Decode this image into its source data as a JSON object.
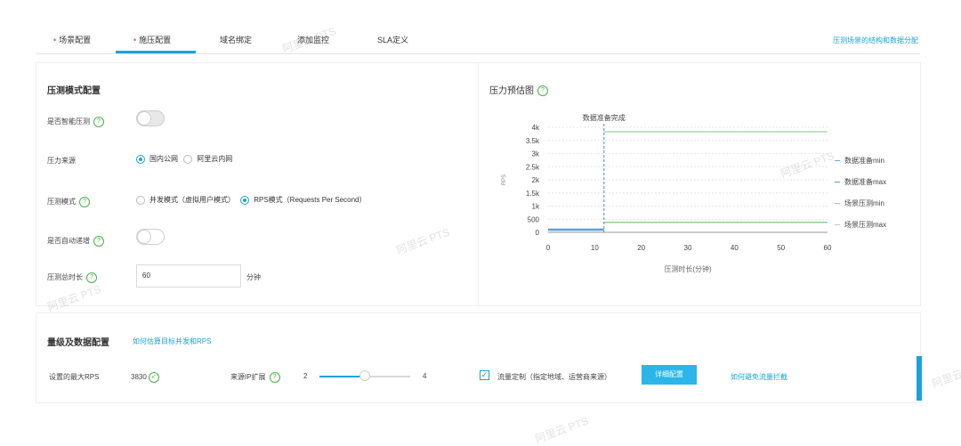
{
  "tabs": [
    {
      "label": "场景配置",
      "required": true
    },
    {
      "label": "施压配置",
      "required": true,
      "active": true
    },
    {
      "label": "域名绑定",
      "required": false
    },
    {
      "label": "添加监控",
      "required": false
    },
    {
      "label": "SLA定义",
      "required": false
    }
  ],
  "tab_required_marker": "•",
  "top_link": "压测场景的结构和数据分配",
  "mode_config": {
    "title": "压测模式配置",
    "smart_label": "是否智能压测",
    "source_label": "压力来源",
    "source_options": [
      "国内公网",
      "阿里云内网"
    ],
    "source_selected": "国内公网",
    "mode_label": "压测模式",
    "mode_options": [
      "并发模式（虚拟用户模式）",
      "RPS模式（Requests Per Second）"
    ],
    "mode_selected": "RPS模式（Requests Per Second）",
    "auto_label": "是否自动递增",
    "duration_label": "压测总时长",
    "duration_value": "60",
    "duration_unit": "分钟"
  },
  "help_glyph": "?",
  "chart_panel": {
    "title": "压力预估图"
  },
  "chart_data": {
    "type": "line",
    "annotation": "数据准备完成",
    "ylabel": "RPS",
    "xlabel": "压测时长(分钟)",
    "x_ticks": [
      "0",
      "10",
      "20",
      "30",
      "40",
      "50",
      "60"
    ],
    "y_ticks": [
      "0",
      "500",
      "1k",
      "1.5k",
      "2k",
      "2.5k",
      "3k",
      "3.5k",
      "4k"
    ],
    "xlim": [
      0,
      60
    ],
    "ylim": [
      0,
      4000
    ],
    "marker_x": 12,
    "series": [
      {
        "name": "数据准备min",
        "color": "#6fa8dc",
        "points": [
          [
            0,
            80
          ],
          [
            12,
            80
          ]
        ]
      },
      {
        "name": "数据准备max",
        "color": "#5b9bd5",
        "points": [
          [
            0,
            120
          ],
          [
            12,
            120
          ]
        ]
      },
      {
        "name": "场景压测min",
        "color": "#93cf95",
        "points": [
          [
            12,
            383
          ],
          [
            60,
            383
          ]
        ]
      },
      {
        "name": "场景压测max",
        "color": "#a8dba9",
        "points": [
          [
            12,
            3830
          ],
          [
            60,
            3830
          ]
        ]
      }
    ],
    "grid": true
  },
  "scale_config": {
    "title": "量级及数据配置",
    "title_link": "如何估算目标并发和RPS",
    "max_rps_label": "设置的最大RPS",
    "max_rps_value": "3830",
    "ok_glyph": "✓",
    "ip_label": "来源IP扩展",
    "ip_min": "2",
    "ip_max": "4",
    "ip_fraction": 0.5,
    "traffic_label": "流量定制（指定地域、运营商来源）",
    "traffic_checked": true,
    "check_glyph": "✓",
    "detail_button": "详细配置",
    "avoid_link": "如何避免流量拦截"
  },
  "watermark_text": "阿里云 PTS"
}
